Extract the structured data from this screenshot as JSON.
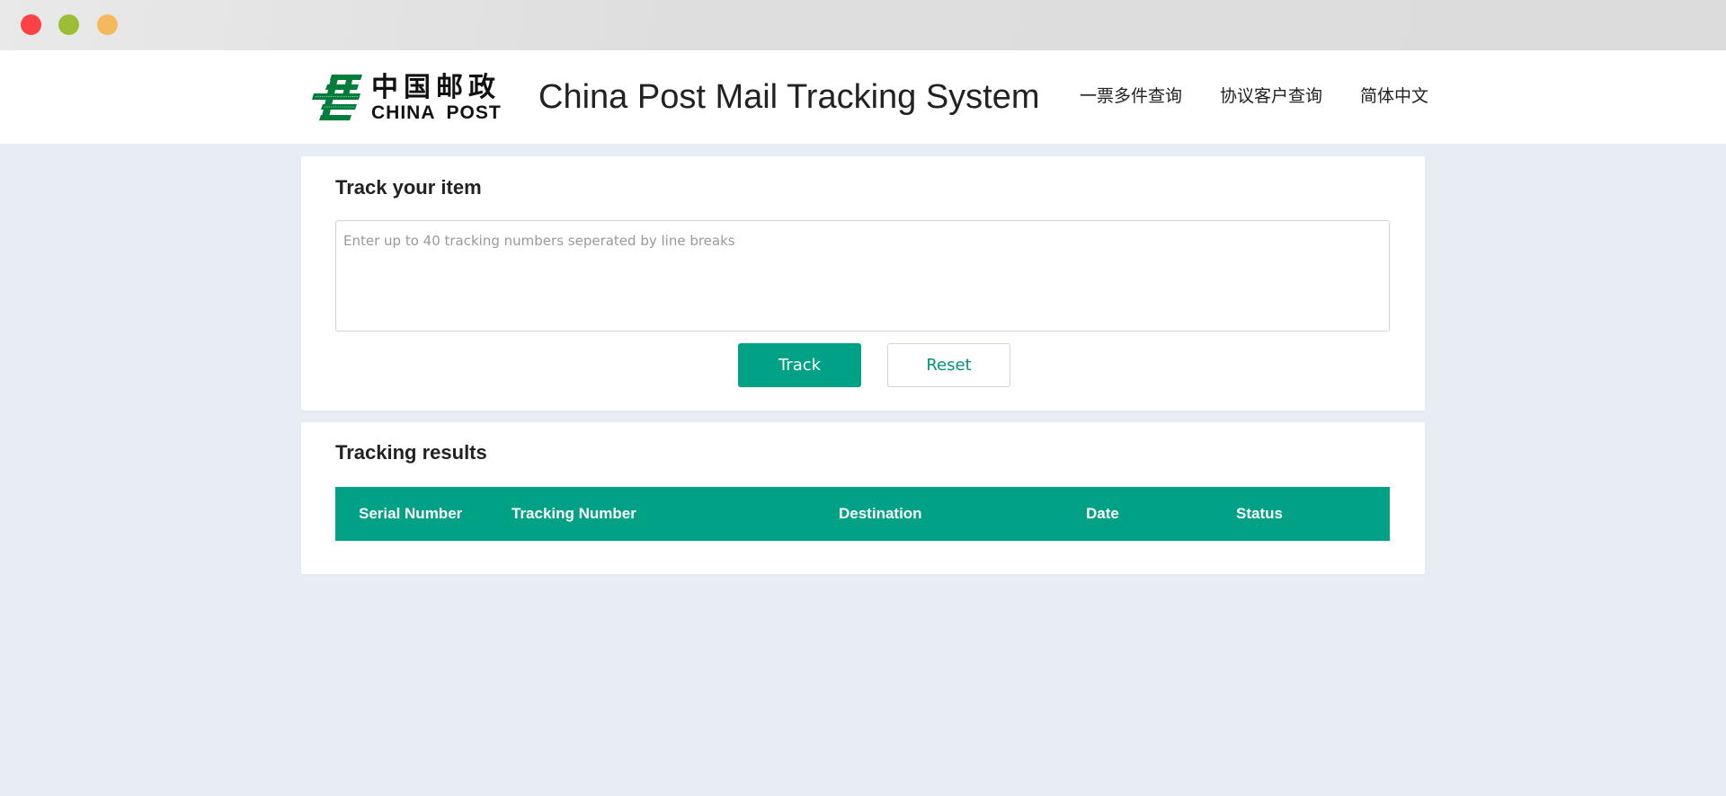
{
  "window": {
    "controls": [
      "close",
      "minimize",
      "maximize"
    ],
    "colors": {
      "close": "#fc4245",
      "minimize": "#9cbd35",
      "maximize": "#f5b95d"
    }
  },
  "header": {
    "logo": {
      "icon": "china-post-logo-icon",
      "chinese_text": "中国邮政",
      "english_text": "CHINA POST",
      "color": "#007d3a"
    },
    "title": "China Post Mail Tracking System",
    "nav": [
      {
        "label": "一票多件查询"
      },
      {
        "label": "协议客户查询"
      },
      {
        "label": "简体中文"
      }
    ]
  },
  "track_section": {
    "title": "Track your item",
    "input": {
      "value": "",
      "placeholder": "Enter up to 40 tracking numbers seperated by line breaks"
    },
    "track_button": "Track",
    "reset_button": "Reset",
    "accent_color": "#00a184"
  },
  "results_section": {
    "title": "Tracking results",
    "columns": [
      "Serial Number",
      "Tracking Number",
      "Destination",
      "Date",
      "Status"
    ],
    "rows": []
  }
}
